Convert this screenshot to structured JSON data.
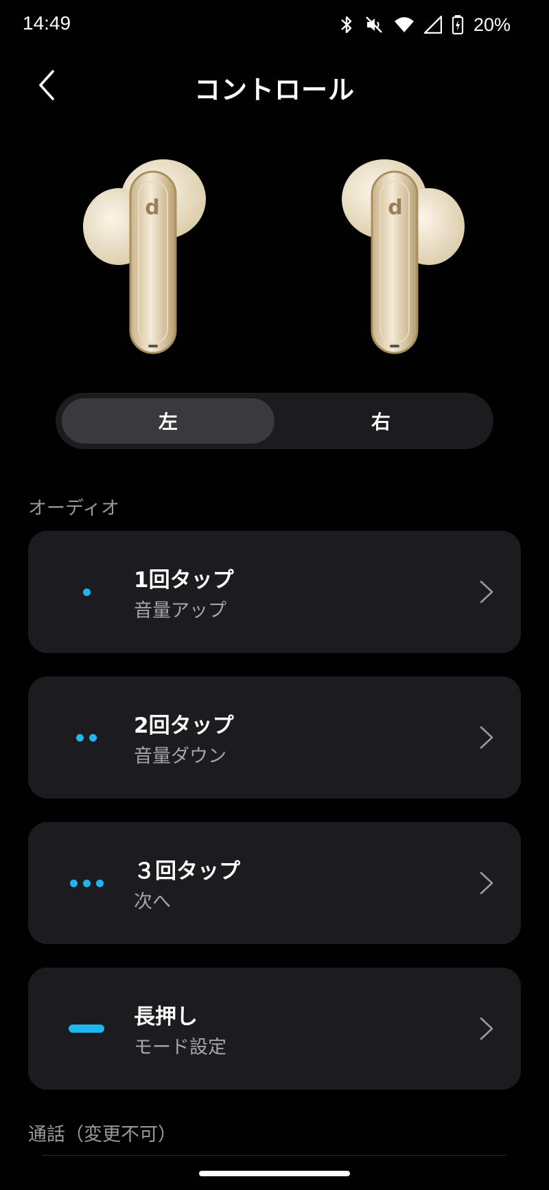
{
  "status_bar": {
    "time": "14:49",
    "battery": "20%",
    "icons": [
      "bluetooth-icon",
      "mute-icon",
      "wifi-icon",
      "signal-icon",
      "battery-charging-icon"
    ]
  },
  "header": {
    "title": "コントロール",
    "back_icon": "chevron-left-icon"
  },
  "product_image": "earbuds-image",
  "side_selector": {
    "options": [
      "左",
      "右"
    ],
    "selected": "左"
  },
  "sections": {
    "audio_label": "オーディオ",
    "call_label": "通話（変更不可）"
  },
  "controls": [
    {
      "title": "1回タップ",
      "value": "音量アップ",
      "icon": "single-dot-icon"
    },
    {
      "title": "2回タップ",
      "value": "音量ダウン",
      "icon": "double-dot-icon"
    },
    {
      "title": "３回タップ",
      "value": "次へ",
      "icon": "triple-dot-icon"
    },
    {
      "title": "長押し",
      "value": "モード設定",
      "icon": "long-press-icon"
    }
  ],
  "colors": {
    "background": "#000000",
    "card": "#1c1c1e",
    "selected_segment": "#3a3a3c",
    "accent": "#1fb6f0",
    "secondary_text": "#a5a5aa"
  }
}
